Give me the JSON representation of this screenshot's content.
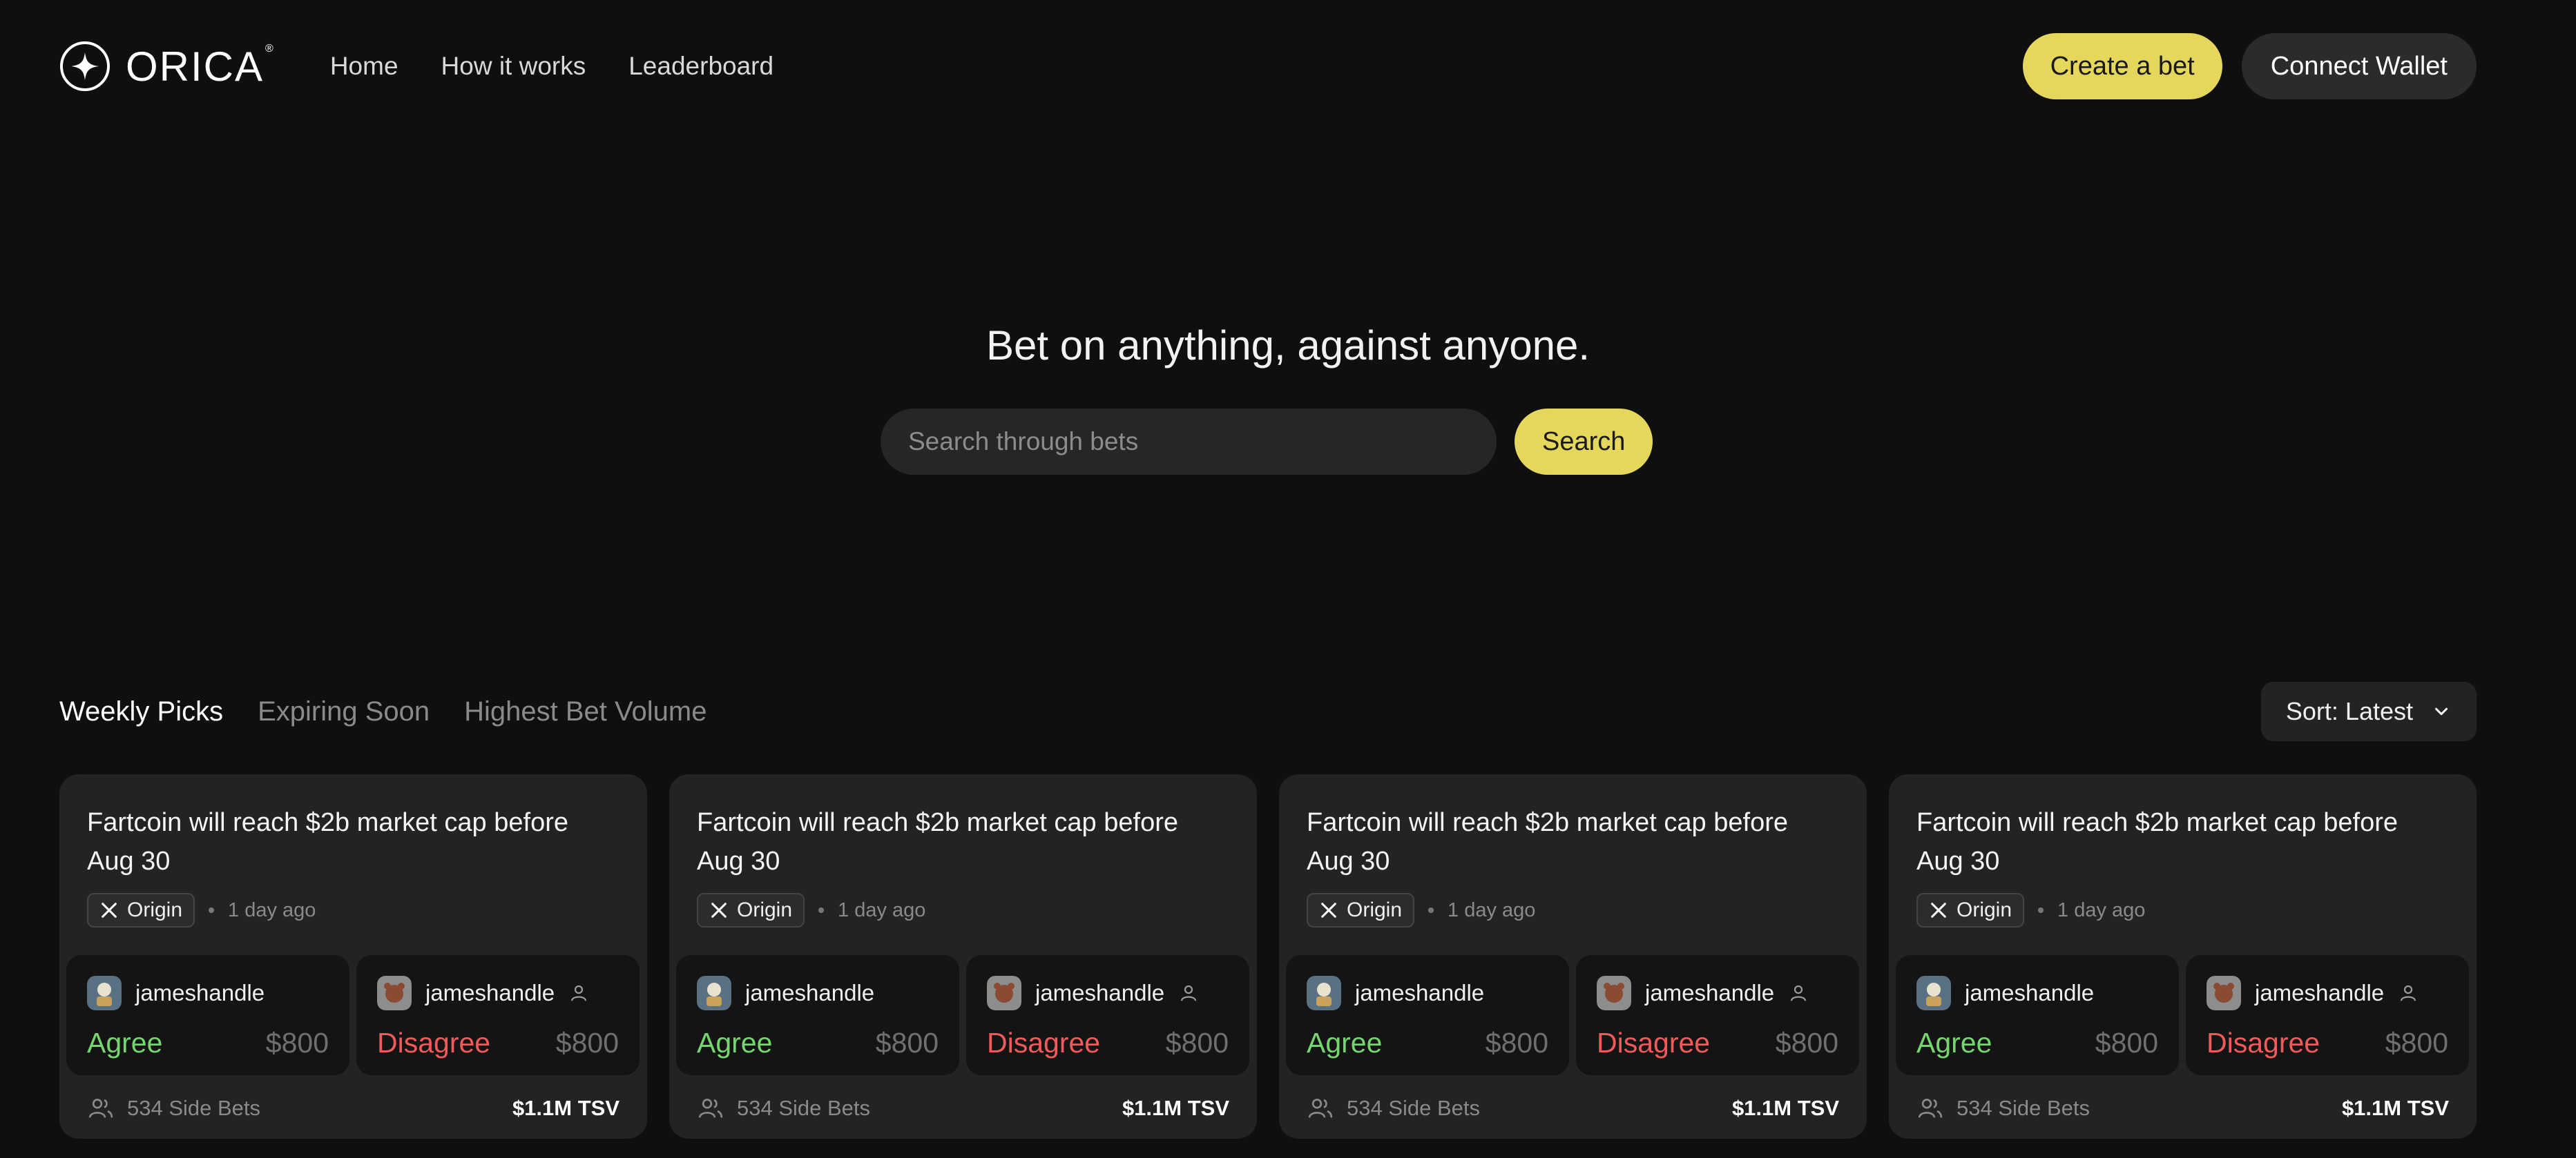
{
  "brand": {
    "name": "ORICA",
    "mark": "®"
  },
  "nav": [
    {
      "label": "Home"
    },
    {
      "label": "How it works"
    },
    {
      "label": "Leaderboard"
    }
  ],
  "header_actions": {
    "create_label": "Create a bet",
    "wallet_label": "Connect Wallet"
  },
  "hero": {
    "title": "Bet on anything, against anyone.",
    "search_placeholder": "Search through bets",
    "search_button": "Search"
  },
  "tabs": [
    {
      "label": "Weekly Picks",
      "active": true
    },
    {
      "label": "Expiring Soon",
      "active": false
    },
    {
      "label": "Highest Bet Volume",
      "active": false
    }
  ],
  "sort": {
    "label": "Sort: Latest"
  },
  "colors": {
    "accent": "#e4d75c",
    "agree": "#75d56f",
    "disagree": "#f15a5a",
    "background": "#0f0f0f",
    "card": "#232323"
  },
  "cards": [
    {
      "title": "Fartcoin will reach $2b market cap before Aug 30",
      "origin_label": "Origin",
      "origin_icon": "x-logo-icon",
      "time": "1 day ago",
      "agree": {
        "user": "jameshandle",
        "label": "Agree",
        "amount": "$800"
      },
      "disagree": {
        "user": "jameshandle",
        "label": "Disagree",
        "amount": "$800"
      },
      "side_bets": "534 Side Bets",
      "tsv": "$1.1M TSV"
    },
    {
      "title": "Fartcoin will reach $2b market cap before Aug 30",
      "origin_label": "Origin",
      "origin_icon": "x-logo-icon",
      "time": "1 day ago",
      "agree": {
        "user": "jameshandle",
        "label": "Agree",
        "amount": "$800"
      },
      "disagree": {
        "user": "jameshandle",
        "label": "Disagree",
        "amount": "$800"
      },
      "side_bets": "534 Side Bets",
      "tsv": "$1.1M TSV"
    },
    {
      "title": "Fartcoin will reach $2b market cap before Aug 30",
      "origin_label": "Origin",
      "origin_icon": "x-logo-icon",
      "time": "1 day ago",
      "agree": {
        "user": "jameshandle",
        "label": "Agree",
        "amount": "$800"
      },
      "disagree": {
        "user": "jameshandle",
        "label": "Disagree",
        "amount": "$800"
      },
      "side_bets": "534 Side Bets",
      "tsv": "$1.1M TSV"
    },
    {
      "title": "Fartcoin will reach $2b market cap before Aug 30",
      "origin_label": "Origin",
      "origin_icon": "x-logo-icon",
      "time": "1 day ago",
      "agree": {
        "user": "jameshandle",
        "label": "Agree",
        "amount": "$800"
      },
      "disagree": {
        "user": "jameshandle",
        "label": "Disagree",
        "amount": "$800"
      },
      "side_bets": "534 Side Bets",
      "tsv": "$1.1M TSV"
    }
  ]
}
